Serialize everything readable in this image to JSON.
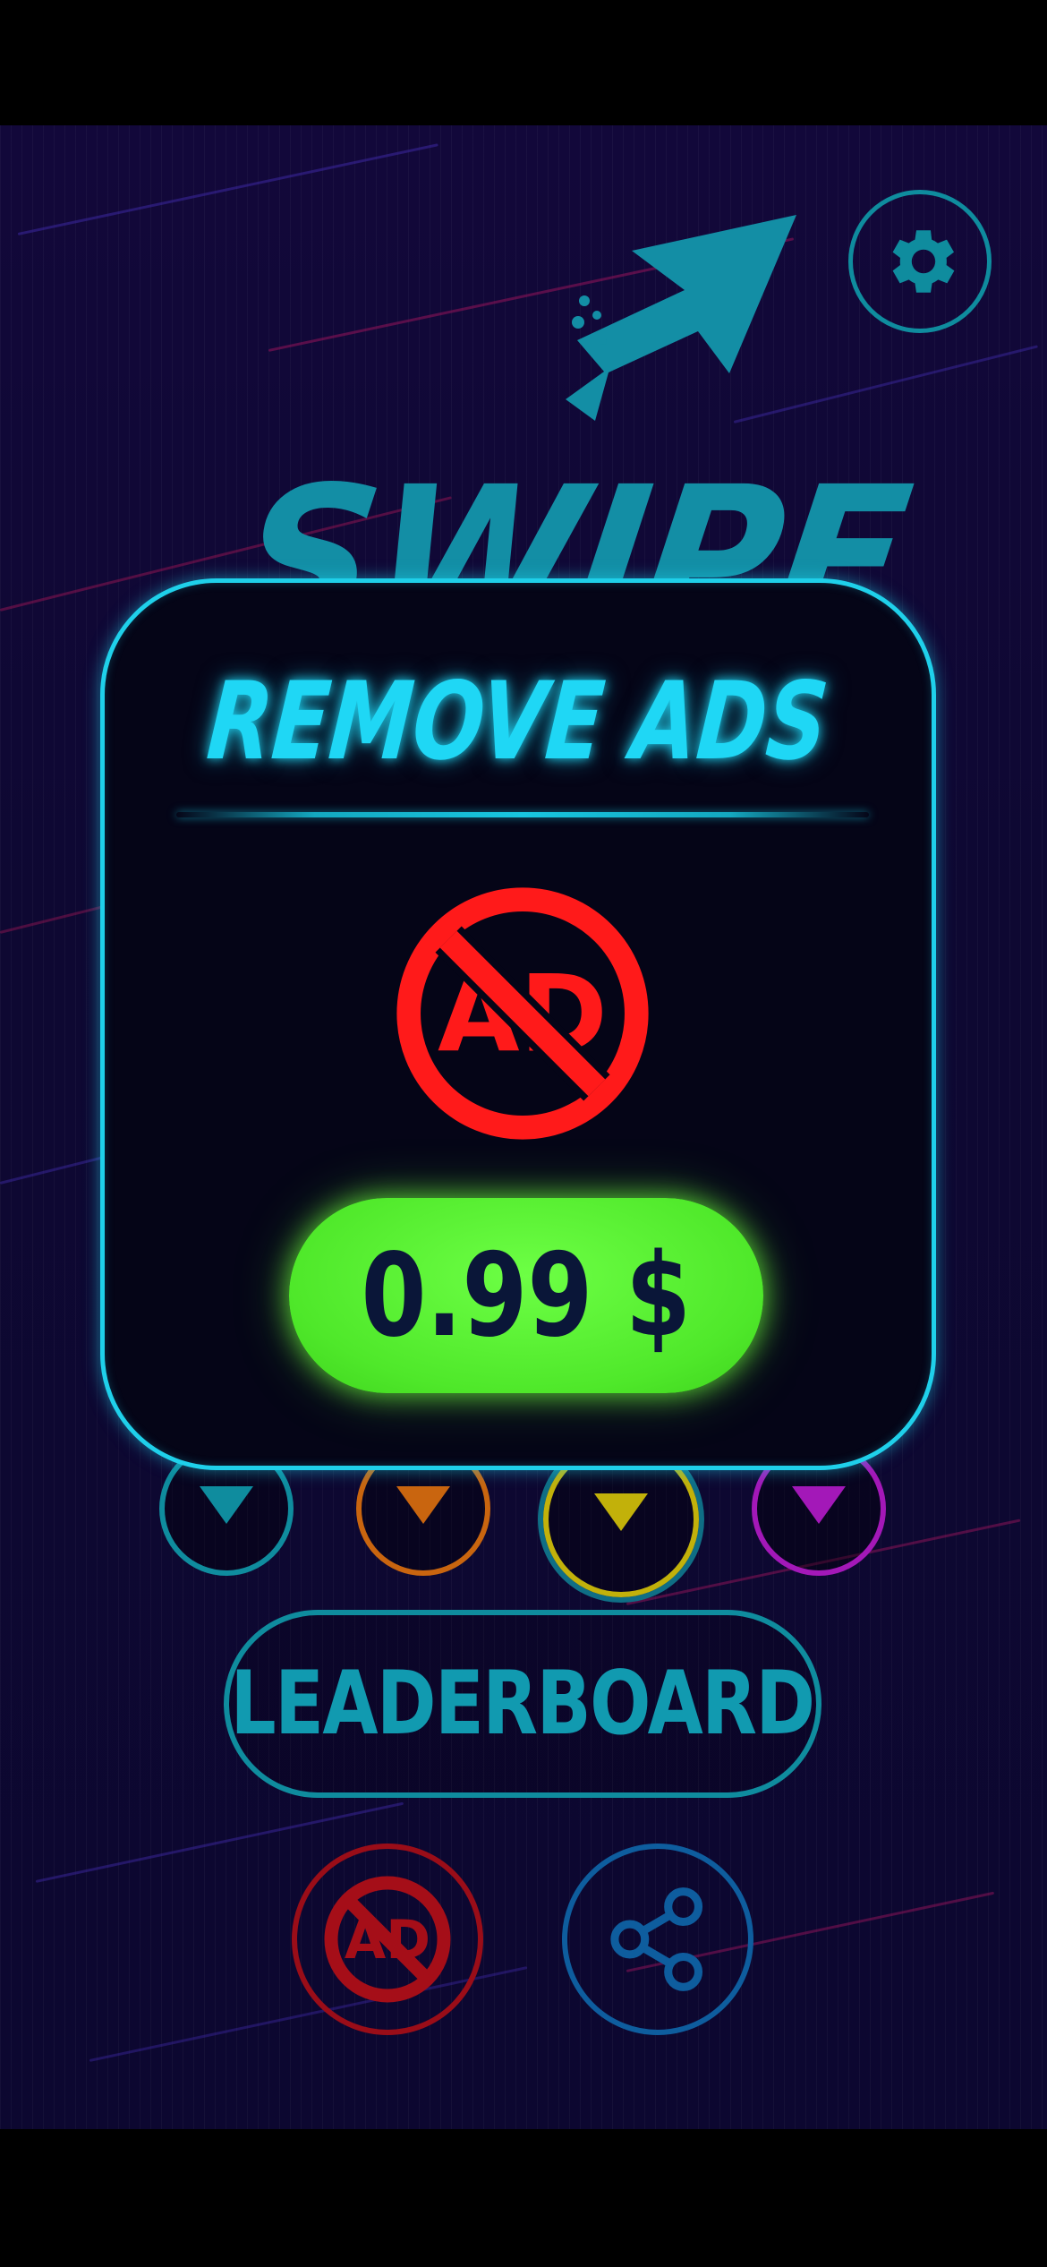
{
  "app": {
    "logo_text": "SWIPE"
  },
  "header": {
    "settings_icon": "gear-icon"
  },
  "modes": [
    {
      "color": "#0f8c9e",
      "icon": "triangle-down-icon"
    },
    {
      "color": "#c9650f",
      "icon": "triangle-down-icon"
    },
    {
      "color": "#c2b10a",
      "icon": "triangle-down-icon"
    },
    {
      "color": "#a318b8",
      "icon": "triangle-down-icon"
    }
  ],
  "main": {
    "leaderboard_label": "LEADERBOARD",
    "remove_ads_icon": "no-ads-icon",
    "share_icon": "share-icon"
  },
  "modal": {
    "title": "REMOVE ADS",
    "icon": "no-ads-icon",
    "price_label": "0.99 $"
  },
  "colors": {
    "accent_cyan": "#1fd0ea",
    "teal": "#0f8c9e",
    "price_green": "#5af02f",
    "no_ads_red": "#ff1a1a",
    "background": "#0e0832"
  }
}
